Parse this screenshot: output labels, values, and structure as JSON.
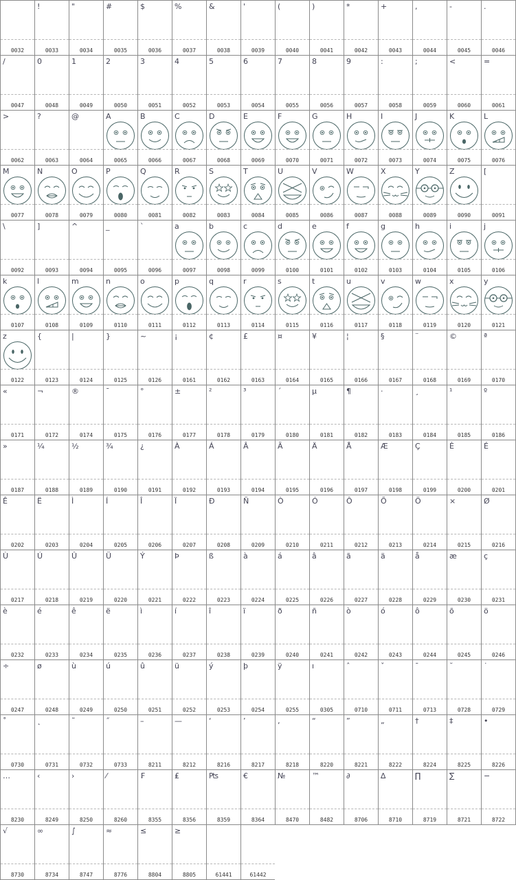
{
  "cells": [
    {
      "glyph": " ",
      "code": "0032"
    },
    {
      "glyph": "!",
      "code": "0033"
    },
    {
      "glyph": "\"",
      "code": "0034"
    },
    {
      "glyph": "#",
      "code": "0035"
    },
    {
      "glyph": "$",
      "code": "0036"
    },
    {
      "glyph": "%",
      "code": "0037"
    },
    {
      "glyph": "&",
      "code": "0038"
    },
    {
      "glyph": "'",
      "code": "0039"
    },
    {
      "glyph": "(",
      "code": "0040"
    },
    {
      "glyph": ")",
      "code": "0041"
    },
    {
      "glyph": "*",
      "code": "0042"
    },
    {
      "glyph": "+",
      "code": "0043"
    },
    {
      "glyph": ",",
      "code": "0044"
    },
    {
      "glyph": "-",
      "code": "0045"
    },
    {
      "glyph": ".",
      "code": "0046"
    },
    {
      "glyph": "/",
      "code": "0047"
    },
    {
      "glyph": "0",
      "code": "0048"
    },
    {
      "glyph": "1",
      "code": "0049"
    },
    {
      "glyph": "2",
      "code": "0050"
    },
    {
      "glyph": "3",
      "code": "0051"
    },
    {
      "glyph": "4",
      "code": "0052"
    },
    {
      "glyph": "5",
      "code": "0053"
    },
    {
      "glyph": "6",
      "code": "0054"
    },
    {
      "glyph": "7",
      "code": "0055"
    },
    {
      "glyph": "8",
      "code": "0056"
    },
    {
      "glyph": "9",
      "code": "0057"
    },
    {
      "glyph": ":",
      "code": "0058"
    },
    {
      "glyph": ";",
      "code": "0059"
    },
    {
      "glyph": "<",
      "code": "0060"
    },
    {
      "glyph": "=",
      "code": "0061"
    },
    {
      "glyph": ">",
      "code": "0062"
    },
    {
      "glyph": "?",
      "code": "0063"
    },
    {
      "glyph": "@",
      "code": "0064"
    },
    {
      "glyph": "A",
      "code": "0065",
      "face": "neutral"
    },
    {
      "glyph": "B",
      "code": "0066",
      "face": "smile"
    },
    {
      "glyph": "C",
      "code": "0067",
      "face": "sad"
    },
    {
      "glyph": "D",
      "code": "0068",
      "face": "angry"
    },
    {
      "glyph": "E",
      "code": "0069",
      "face": "grin"
    },
    {
      "glyph": "F",
      "code": "0070",
      "face": "grin"
    },
    {
      "glyph": "G",
      "code": "0071",
      "face": "neutral"
    },
    {
      "glyph": "H",
      "code": "0072",
      "face": "smirk"
    },
    {
      "glyph": "I",
      "code": "0073",
      "face": "bored"
    },
    {
      "glyph": "J",
      "code": "0074",
      "face": "mustache"
    },
    {
      "glyph": "K",
      "code": "0075",
      "face": "shock"
    },
    {
      "glyph": "L",
      "code": "0076",
      "face": "teeth"
    },
    {
      "glyph": "M",
      "code": "0077",
      "face": "grin"
    },
    {
      "glyph": "N",
      "code": "0078",
      "face": "kiss"
    },
    {
      "glyph": "O",
      "code": "0079",
      "face": "happy-closed"
    },
    {
      "glyph": "P",
      "code": "0080",
      "face": "yawn"
    },
    {
      "glyph": "Q",
      "code": "0081",
      "face": "content"
    },
    {
      "glyph": "R",
      "code": "0082",
      "face": "mischief"
    },
    {
      "glyph": "S",
      "code": "0083",
      "face": "stars"
    },
    {
      "glyph": "T",
      "code": "0084",
      "face": "scared"
    },
    {
      "glyph": "U",
      "code": "0085",
      "face": "xeyes"
    },
    {
      "glyph": "V",
      "code": "0086",
      "face": "wink"
    },
    {
      "glyph": "W",
      "code": "0087",
      "face": "meh"
    },
    {
      "glyph": "X",
      "code": "0088",
      "face": "cat"
    },
    {
      "glyph": "Y",
      "code": "0089",
      "face": "glasses"
    },
    {
      "glyph": "Z",
      "code": "0090",
      "face": "bigsmile"
    },
    {
      "glyph": "[",
      "code": "0091"
    },
    {
      "glyph": "\\",
      "code": "0092"
    },
    {
      "glyph": "]",
      "code": "0093"
    },
    {
      "glyph": "^",
      "code": "0094"
    },
    {
      "glyph": "_",
      "code": "0095"
    },
    {
      "glyph": "`",
      "code": "0096"
    },
    {
      "glyph": "a",
      "code": "0097",
      "face": "neutral"
    },
    {
      "glyph": "b",
      "code": "0098",
      "face": "smile"
    },
    {
      "glyph": "c",
      "code": "0099",
      "face": "sad"
    },
    {
      "glyph": "d",
      "code": "0100",
      "face": "angry"
    },
    {
      "glyph": "e",
      "code": "0101",
      "face": "grin"
    },
    {
      "glyph": "f",
      "code": "0102",
      "face": "grin"
    },
    {
      "glyph": "g",
      "code": "0103",
      "face": "neutral"
    },
    {
      "glyph": "h",
      "code": "0104",
      "face": "smirk"
    },
    {
      "glyph": "i",
      "code": "0105",
      "face": "bored"
    },
    {
      "glyph": "j",
      "code": "0106",
      "face": "mustache"
    },
    {
      "glyph": "k",
      "code": "0107",
      "face": "shock"
    },
    {
      "glyph": "l",
      "code": "0108",
      "face": "teeth"
    },
    {
      "glyph": "m",
      "code": "0109",
      "face": "grin"
    },
    {
      "glyph": "n",
      "code": "0110",
      "face": "kiss"
    },
    {
      "glyph": "o",
      "code": "0111",
      "face": "happy-closed"
    },
    {
      "glyph": "p",
      "code": "0112",
      "face": "yawn"
    },
    {
      "glyph": "q",
      "code": "0113",
      "face": "content"
    },
    {
      "glyph": "r",
      "code": "0114",
      "face": "mischief"
    },
    {
      "glyph": "s",
      "code": "0115",
      "face": "stars"
    },
    {
      "glyph": "t",
      "code": "0116",
      "face": "scared"
    },
    {
      "glyph": "u",
      "code": "0117",
      "face": "xeyes"
    },
    {
      "glyph": "v",
      "code": "0118",
      "face": "wink"
    },
    {
      "glyph": "w",
      "code": "0119",
      "face": "meh"
    },
    {
      "glyph": "x",
      "code": "0120",
      "face": "cat"
    },
    {
      "glyph": "y",
      "code": "0121",
      "face": "glasses"
    },
    {
      "glyph": "z",
      "code": "0122",
      "face": "bigsmile"
    },
    {
      "glyph": "{",
      "code": "0123"
    },
    {
      "glyph": "|",
      "code": "0124"
    },
    {
      "glyph": "}",
      "code": "0125"
    },
    {
      "glyph": "~",
      "code": "0126"
    },
    {
      "glyph": "¡",
      "code": "0161"
    },
    {
      "glyph": "¢",
      "code": "0162"
    },
    {
      "glyph": "£",
      "code": "0163"
    },
    {
      "glyph": "¤",
      "code": "0164"
    },
    {
      "glyph": "¥",
      "code": "0165"
    },
    {
      "glyph": "¦",
      "code": "0166"
    },
    {
      "glyph": "§",
      "code": "0167"
    },
    {
      "glyph": "¨",
      "code": "0168"
    },
    {
      "glyph": "©",
      "code": "0169"
    },
    {
      "glyph": "ª",
      "code": "0170"
    },
    {
      "glyph": "«",
      "code": "0171"
    },
    {
      "glyph": "¬",
      "code": "0172"
    },
    {
      "glyph": "®",
      "code": "0174"
    },
    {
      "glyph": "¯",
      "code": "0175"
    },
    {
      "glyph": "°",
      "code": "0176"
    },
    {
      "glyph": "±",
      "code": "0177"
    },
    {
      "glyph": "²",
      "code": "0178"
    },
    {
      "glyph": "³",
      "code": "0179"
    },
    {
      "glyph": "´",
      "code": "0180"
    },
    {
      "glyph": "µ",
      "code": "0181"
    },
    {
      "glyph": "¶",
      "code": "0182"
    },
    {
      "glyph": "·",
      "code": "0183"
    },
    {
      "glyph": "¸",
      "code": "0184"
    },
    {
      "glyph": "¹",
      "code": "0185"
    },
    {
      "glyph": "º",
      "code": "0186"
    },
    {
      "glyph": "»",
      "code": "0187"
    },
    {
      "glyph": "¼",
      "code": "0188"
    },
    {
      "glyph": "½",
      "code": "0189"
    },
    {
      "glyph": "¾",
      "code": "0190"
    },
    {
      "glyph": "¿",
      "code": "0191"
    },
    {
      "glyph": "À",
      "code": "0192"
    },
    {
      "glyph": "Á",
      "code": "0193"
    },
    {
      "glyph": "Â",
      "code": "0194"
    },
    {
      "glyph": "Ã",
      "code": "0195"
    },
    {
      "glyph": "Ä",
      "code": "0196"
    },
    {
      "glyph": "Å",
      "code": "0197"
    },
    {
      "glyph": "Æ",
      "code": "0198"
    },
    {
      "glyph": "Ç",
      "code": "0199"
    },
    {
      "glyph": "È",
      "code": "0200"
    },
    {
      "glyph": "É",
      "code": "0201"
    },
    {
      "glyph": "Ê",
      "code": "0202"
    },
    {
      "glyph": "Ë",
      "code": "0203"
    },
    {
      "glyph": "Ì",
      "code": "0204"
    },
    {
      "glyph": "Í",
      "code": "0205"
    },
    {
      "glyph": "Î",
      "code": "0206"
    },
    {
      "glyph": "Ï",
      "code": "0207"
    },
    {
      "glyph": "Ð",
      "code": "0208"
    },
    {
      "glyph": "Ñ",
      "code": "0209"
    },
    {
      "glyph": "Ò",
      "code": "0210"
    },
    {
      "glyph": "Ó",
      "code": "0211"
    },
    {
      "glyph": "Ô",
      "code": "0212"
    },
    {
      "glyph": "Õ",
      "code": "0213"
    },
    {
      "glyph": "Ö",
      "code": "0214"
    },
    {
      "glyph": "×",
      "code": "0215"
    },
    {
      "glyph": "Ø",
      "code": "0216"
    },
    {
      "glyph": "Ù",
      "code": "0217"
    },
    {
      "glyph": "Ú",
      "code": "0218"
    },
    {
      "glyph": "Û",
      "code": "0219"
    },
    {
      "glyph": "Ü",
      "code": "0220"
    },
    {
      "glyph": "Ý",
      "code": "0221"
    },
    {
      "glyph": "Þ",
      "code": "0222"
    },
    {
      "glyph": "ß",
      "code": "0223"
    },
    {
      "glyph": "à",
      "code": "0224"
    },
    {
      "glyph": "á",
      "code": "0225"
    },
    {
      "glyph": "â",
      "code": "0226"
    },
    {
      "glyph": "ã",
      "code": "0227"
    },
    {
      "glyph": "ä",
      "code": "0228"
    },
    {
      "glyph": "å",
      "code": "0229"
    },
    {
      "glyph": "æ",
      "code": "0230"
    },
    {
      "glyph": "ç",
      "code": "0231"
    },
    {
      "glyph": "è",
      "code": "0232"
    },
    {
      "glyph": "é",
      "code": "0233"
    },
    {
      "glyph": "ê",
      "code": "0234"
    },
    {
      "glyph": "ë",
      "code": "0235"
    },
    {
      "glyph": "ì",
      "code": "0236"
    },
    {
      "glyph": "í",
      "code": "0237"
    },
    {
      "glyph": "î",
      "code": "0238"
    },
    {
      "glyph": "ï",
      "code": "0239"
    },
    {
      "glyph": "ð",
      "code": "0240"
    },
    {
      "glyph": "ñ",
      "code": "0241"
    },
    {
      "glyph": "ò",
      "code": "0242"
    },
    {
      "glyph": "ó",
      "code": "0243"
    },
    {
      "glyph": "ô",
      "code": "0244"
    },
    {
      "glyph": "õ",
      "code": "0245"
    },
    {
      "glyph": "ö",
      "code": "0246"
    },
    {
      "glyph": "÷",
      "code": "0247"
    },
    {
      "glyph": "ø",
      "code": "0248"
    },
    {
      "glyph": "ù",
      "code": "0249"
    },
    {
      "glyph": "ú",
      "code": "0250"
    },
    {
      "glyph": "û",
      "code": "0251"
    },
    {
      "glyph": "ü",
      "code": "0252"
    },
    {
      "glyph": "ý",
      "code": "0253"
    },
    {
      "glyph": "þ",
      "code": "0254"
    },
    {
      "glyph": "ÿ",
      "code": "0255"
    },
    {
      "glyph": "ı",
      "code": "0305"
    },
    {
      "glyph": "ˆ",
      "code": "0710"
    },
    {
      "glyph": "ˇ",
      "code": "0711"
    },
    {
      "glyph": "ˉ",
      "code": "0713"
    },
    {
      "glyph": "˘",
      "code": "0728"
    },
    {
      "glyph": "˙",
      "code": "0729"
    },
    {
      "glyph": "˚",
      "code": "0730"
    },
    {
      "glyph": "˛",
      "code": "0731"
    },
    {
      "glyph": "˜",
      "code": "0732"
    },
    {
      "glyph": "˝",
      "code": "0733"
    },
    {
      "glyph": "–",
      "code": "8211"
    },
    {
      "glyph": "—",
      "code": "8212"
    },
    {
      "glyph": "‘",
      "code": "8216"
    },
    {
      "glyph": "’",
      "code": "8217"
    },
    {
      "glyph": "‚",
      "code": "8218"
    },
    {
      "glyph": "“",
      "code": "8220"
    },
    {
      "glyph": "”",
      "code": "8221"
    },
    {
      "glyph": "„",
      "code": "8222"
    },
    {
      "glyph": "†",
      "code": "8224"
    },
    {
      "glyph": "‡",
      "code": "8225"
    },
    {
      "glyph": "•",
      "code": "8226"
    },
    {
      "glyph": "…",
      "code": "8230"
    },
    {
      "glyph": "‹",
      "code": "8249"
    },
    {
      "glyph": "›",
      "code": "8250"
    },
    {
      "glyph": "⁄",
      "code": "8260"
    },
    {
      "glyph": "₣",
      "code": "8355"
    },
    {
      "glyph": "₤",
      "code": "8356"
    },
    {
      "glyph": "₧",
      "code": "8359"
    },
    {
      "glyph": "€",
      "code": "8364"
    },
    {
      "glyph": "№",
      "code": "8470"
    },
    {
      "glyph": "™",
      "code": "8482"
    },
    {
      "glyph": "∂",
      "code": "8706"
    },
    {
      "glyph": "∆",
      "code": "8710"
    },
    {
      "glyph": "∏",
      "code": "8719"
    },
    {
      "glyph": "∑",
      "code": "8721"
    },
    {
      "glyph": "−",
      "code": "8722"
    },
    {
      "glyph": "√",
      "code": "8730"
    },
    {
      "glyph": "∞",
      "code": "8734"
    },
    {
      "glyph": "∫",
      "code": "8747"
    },
    {
      "glyph": "≈",
      "code": "8776"
    },
    {
      "glyph": "≤",
      "code": "8804"
    },
    {
      "glyph": "≥",
      "code": "8805"
    },
    {
      "glyph": "",
      "code": "61441"
    },
    {
      "glyph": "",
      "code": "61442"
    }
  ]
}
